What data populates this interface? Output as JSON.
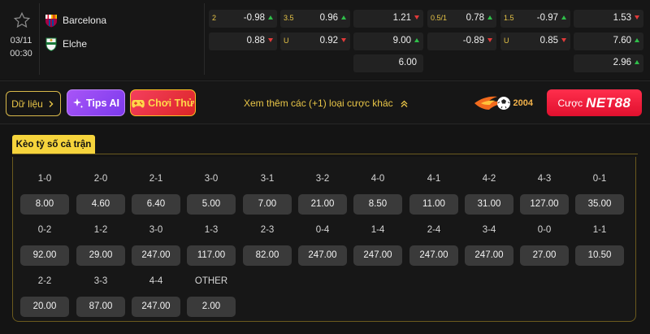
{
  "match": {
    "date": "03/11",
    "time": "00:30",
    "home": "Barcelona",
    "away": "Elche",
    "odds": [
      {
        "label": "2",
        "value": "-0.98",
        "dir": "up"
      },
      {
        "label": "0.5/1",
        "value": "0.78",
        "dir": "up"
      },
      {
        "label": "",
        "value": "0.88",
        "dir": "down"
      },
      {
        "label": "",
        "value": "-0.89",
        "dir": "down"
      },
      {
        "label": "3.5",
        "value": "0.96",
        "dir": "up"
      },
      {
        "label": "1.5",
        "value": "-0.97",
        "dir": "up"
      },
      {
        "label": "U",
        "value": "0.92",
        "dir": "down"
      },
      {
        "label": "U",
        "value": "0.85",
        "dir": "down"
      },
      {
        "label": "",
        "value": "1.21",
        "dir": "down"
      },
      {
        "label": "",
        "value": "1.53",
        "dir": "down"
      },
      {
        "label": "",
        "value": "9.00",
        "dir": "up"
      },
      {
        "label": "",
        "value": "7.60",
        "dir": "up"
      },
      {
        "label": "",
        "value": "6.00",
        "dir": "none"
      },
      {
        "label": "",
        "value": "2.96",
        "dir": "up"
      }
    ]
  },
  "actions": {
    "data_label": "Dữ liệu",
    "tips_label": "Tips AI",
    "play_label": "Chơi Thử",
    "more_label": "Xem thêm các (+1) loại cược khác",
    "promo_year": "2004",
    "bet_prefix": "Cược",
    "bet_brand": "NET88"
  },
  "tab_label": "Kèo tỷ số cả trận",
  "scores": [
    {
      "score": "1-0",
      "odds": "8.00"
    },
    {
      "score": "2-0",
      "odds": "4.60"
    },
    {
      "score": "2-1",
      "odds": "6.40"
    },
    {
      "score": "3-0",
      "odds": "5.00"
    },
    {
      "score": "3-1",
      "odds": "7.00"
    },
    {
      "score": "3-2",
      "odds": "21.00"
    },
    {
      "score": "4-0",
      "odds": "8.50"
    },
    {
      "score": "4-1",
      "odds": "11.00"
    },
    {
      "score": "4-2",
      "odds": "31.00"
    },
    {
      "score": "4-3",
      "odds": "127.00"
    },
    {
      "score": "0-1",
      "odds": "35.00"
    },
    {
      "score": "0-2",
      "odds": "92.00"
    },
    {
      "score": "1-2",
      "odds": "29.00"
    },
    {
      "score": "3-0",
      "odds": "247.00"
    },
    {
      "score": "1-3",
      "odds": "117.00"
    },
    {
      "score": "2-3",
      "odds": "82.00"
    },
    {
      "score": "0-4",
      "odds": "247.00"
    },
    {
      "score": "1-4",
      "odds": "247.00"
    },
    {
      "score": "2-4",
      "odds": "247.00"
    },
    {
      "score": "3-4",
      "odds": "247.00"
    },
    {
      "score": "0-0",
      "odds": "27.00"
    },
    {
      "score": "1-1",
      "odds": "10.50"
    },
    {
      "score": "2-2",
      "odds": "20.00"
    },
    {
      "score": "3-3",
      "odds": "87.00"
    },
    {
      "score": "4-4",
      "odds": "247.00"
    },
    {
      "score": "OTHER",
      "odds": "2.00"
    }
  ],
  "colors": {
    "accent": "#f6d43c",
    "up": "#2fbf4a",
    "down": "#e23a3a"
  },
  "icons": [
    "star-icon",
    "barcelona-crest-icon",
    "elche-crest-icon",
    "chevron-right-icon",
    "sparkle-icon",
    "gamepad-icon",
    "double-chevron-up-icon",
    "football-fire-icon"
  ]
}
